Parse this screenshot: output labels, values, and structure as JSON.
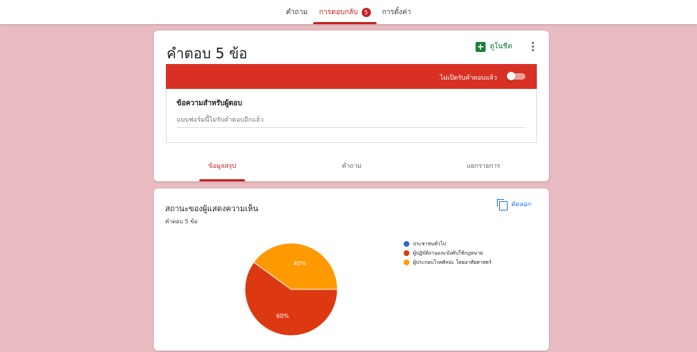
{
  "top_tabs": [
    {
      "label": "คำถาม",
      "active": false
    },
    {
      "label": "การตอบกลับ",
      "active": true,
      "badge": "5"
    },
    {
      "label": "การตั้งค่า",
      "active": false
    }
  ],
  "responses_card": {
    "title": "คำตอบ 5 ข้อ",
    "sheets_label": "ดูในชีต",
    "more_icon": "more-vert-icon",
    "closed_bar": {
      "label": "ไม่เปิดรับคำตอบแล้ว",
      "accepting": false,
      "color": "#d93025"
    },
    "message": {
      "label": "ข้อความสำหรับผู้ตอบ",
      "placeholder": "แบบฟอร์มนี้ไม่รับคำตอบอีกแล้ว",
      "value": ""
    },
    "sub_tabs": [
      {
        "label": "ข้อมูลสรุป",
        "active": true
      },
      {
        "label": "คำถาม",
        "active": false
      },
      {
        "label": "แยกรายการ",
        "active": false
      }
    ]
  },
  "summary_card": {
    "question": "สถานะของผู้แสดงความเห็น",
    "count_label": "คำตอบ 5 ข้อ",
    "copy_label": "คัดลอก"
  },
  "chart_data": {
    "type": "pie",
    "categories": [
      "ประชาชนทั่วไป",
      "ผู้ปฏิบัติงานและบังคับใช้กฎหมาย",
      "ผู้ประกอบโรคศิลปะ โดยอาศัยศาสตร์"
    ],
    "values": [
      0,
      60,
      40
    ],
    "slice_labels": [
      "",
      "60%",
      "40%"
    ],
    "colors": [
      "#3366cc",
      "#dc3912",
      "#ff9900"
    ],
    "legend_position": "right"
  },
  "colors": {
    "background": "#e8bcc1",
    "accent": "#c5221f",
    "sheets_green": "#188038",
    "link_blue": "#1a73e8"
  }
}
